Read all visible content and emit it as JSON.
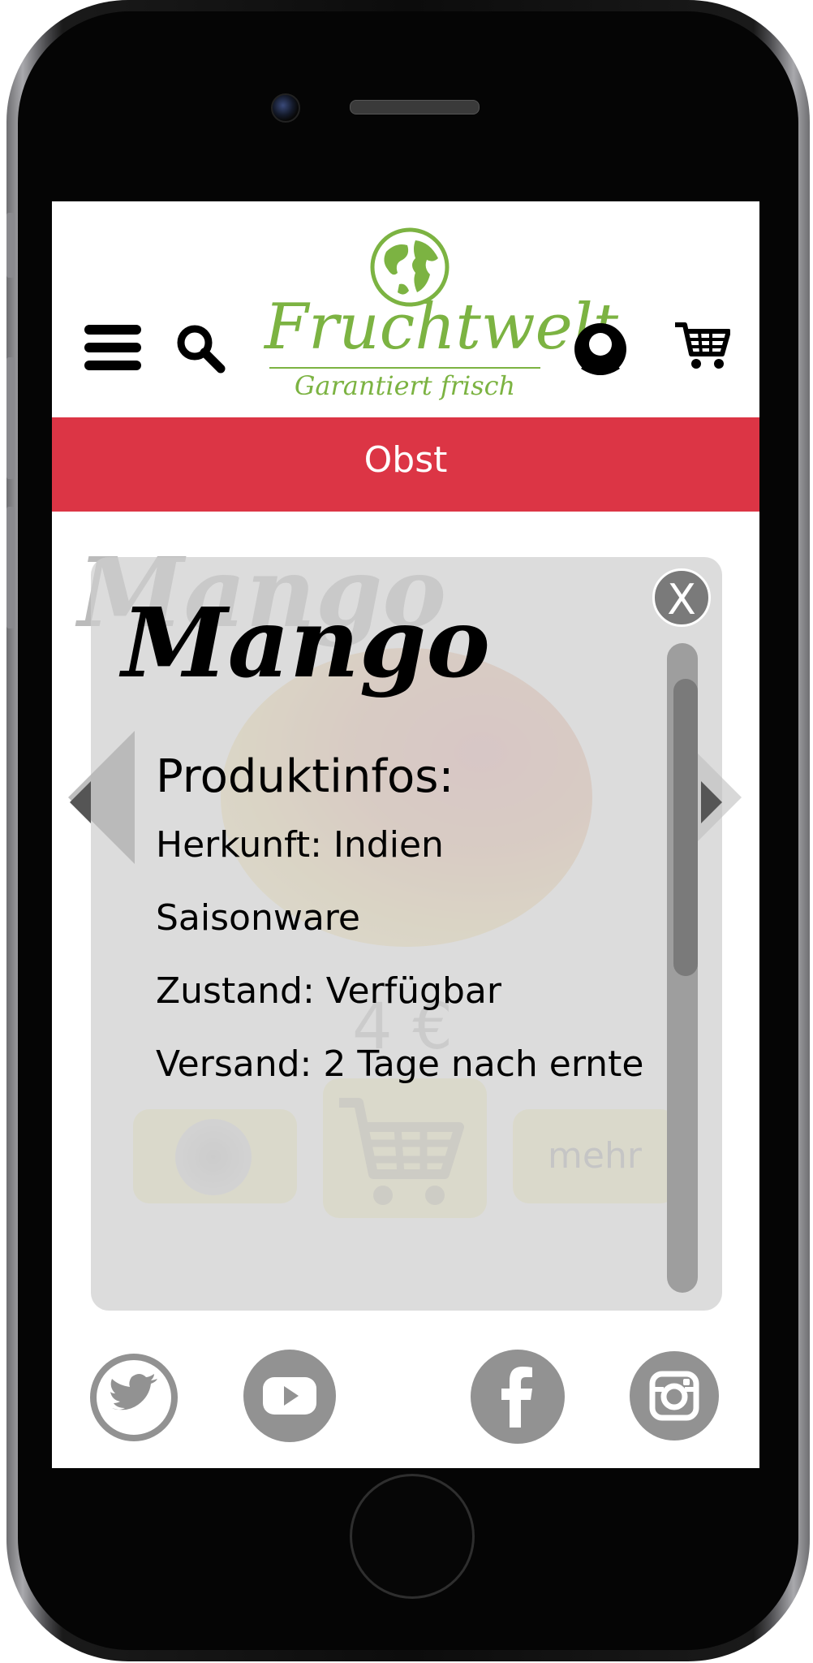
{
  "header": {
    "logo": {
      "name": "Fruchtwelt",
      "slogan": "Garantiert frisch"
    },
    "icons": {
      "menu": "hamburger-menu-icon",
      "search": "search-icon",
      "account": "account-icon",
      "cart": "shopping-cart-icon"
    }
  },
  "category": {
    "label": "Obst"
  },
  "product": {
    "name": "Mango",
    "price": "4 €",
    "more_label": "mehr"
  },
  "info_panel": {
    "close_label": "X",
    "title": "Produktinfos:",
    "lines": [
      "Herkunft: Indien",
      "Saisonware",
      "Zustand: Verfügbar",
      "Versand: 2 Tage nach ernte"
    ]
  },
  "social": {
    "icons": [
      "twitter-icon",
      "youtube-icon",
      "facebook-icon",
      "instagram-icon"
    ]
  },
  "colors": {
    "brand_green": "#7cb342",
    "category_red": "#dc3545",
    "overlay_gray": "#cecece"
  }
}
